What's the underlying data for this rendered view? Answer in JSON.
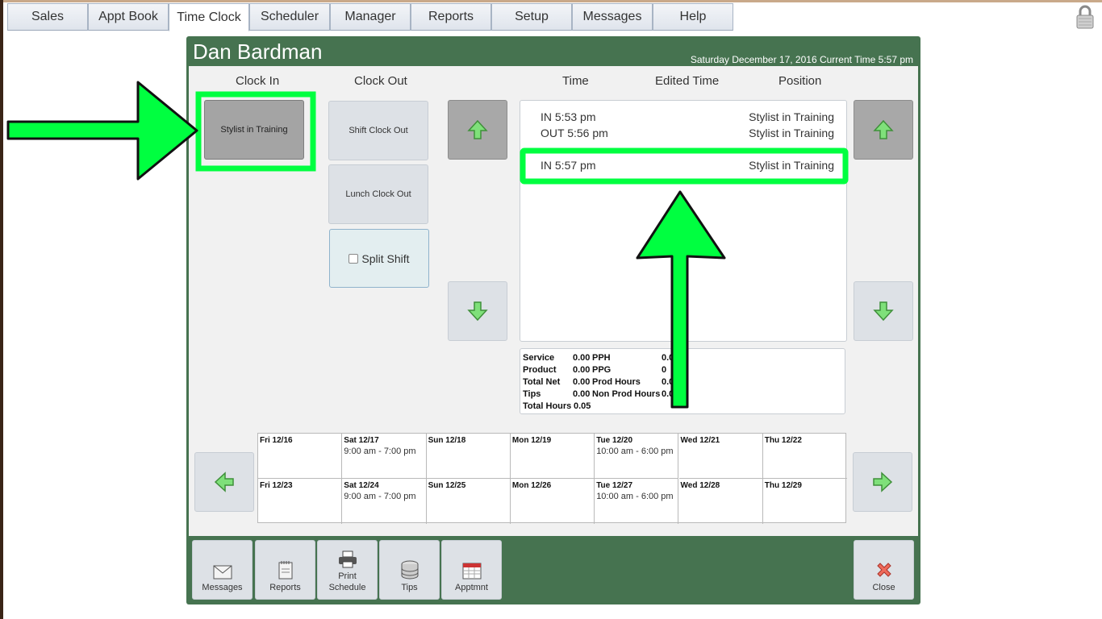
{
  "nav": {
    "tabs": [
      {
        "label": "Sales"
      },
      {
        "label": "Appt Book"
      },
      {
        "label": "Time Clock"
      },
      {
        "label": "Scheduler"
      },
      {
        "label": "Manager"
      },
      {
        "label": "Reports"
      },
      {
        "label": "Setup"
      },
      {
        "label": "Messages"
      },
      {
        "label": "Help"
      }
    ],
    "active": "Time Clock"
  },
  "header": {
    "employee_name": "Dan Bardman",
    "date_line": "Saturday December 17, 2016 Current Time 5:57 pm"
  },
  "columns": {
    "clock_in": "Clock In",
    "clock_out": "Clock Out",
    "time": "Time",
    "edited_time": "Edited Time",
    "position": "Position"
  },
  "clock_in_buttons": [
    "Stylist in Training"
  ],
  "clock_out_buttons": {
    "shift": "Shift Clock Out",
    "lunch": "Lunch Clock Out",
    "split_shift": "Split Shift"
  },
  "punches": [
    {
      "time": "IN 5:53 pm",
      "position": "Stylist in Training"
    },
    {
      "time": "OUT 5:56 pm",
      "position": "Stylist in Training"
    },
    {
      "time": "IN 5:57 pm",
      "position": "Stylist in Training"
    }
  ],
  "stats": {
    "service": {
      "label": "Service",
      "value": "0.00"
    },
    "product": {
      "label": "Product",
      "value": "0.00"
    },
    "total_net": {
      "label": "Total Net",
      "value": "0.00"
    },
    "tips": {
      "label": "Tips",
      "value": "0.00"
    },
    "total_hours": {
      "label": "Total Hours",
      "value": "0.05"
    },
    "pph": {
      "label": "PPH",
      "value": "0.0"
    },
    "ppg": {
      "label": "PPG",
      "value": "0"
    },
    "prod_hours": {
      "label": "Prod Hours",
      "value": "0.0"
    },
    "non_prod_hours": {
      "label": "Non Prod Hours",
      "value": "0.0"
    }
  },
  "schedule": {
    "week1": [
      {
        "day": "Fri 12/16",
        "shift": ""
      },
      {
        "day": "Sat 12/17",
        "shift": "9:00 am - 7:00 pm"
      },
      {
        "day": "Sun 12/18",
        "shift": ""
      },
      {
        "day": "Mon 12/19",
        "shift": ""
      },
      {
        "day": "Tue 12/20",
        "shift": "10:00 am - 6:00 pm"
      },
      {
        "day": "Wed 12/21",
        "shift": ""
      },
      {
        "day": "Thu 12/22",
        "shift": ""
      }
    ],
    "week2": [
      {
        "day": "Fri 12/23",
        "shift": ""
      },
      {
        "day": "Sat 12/24",
        "shift": "9:00 am - 7:00 pm"
      },
      {
        "day": "Sun 12/25",
        "shift": ""
      },
      {
        "day": "Mon 12/26",
        "shift": ""
      },
      {
        "day": "Tue 12/27",
        "shift": "10:00 am - 6:00 pm"
      },
      {
        "day": "Wed 12/28",
        "shift": ""
      },
      {
        "day": "Thu 12/29",
        "shift": ""
      }
    ]
  },
  "toolbar": {
    "messages": "Messages",
    "reports": "Reports",
    "print_schedule_1": "Print",
    "print_schedule_2": "Schedule",
    "tips": "Tips",
    "appointment": "Apptmnt",
    "close": "Close"
  },
  "colors": {
    "panel_green": "#467350",
    "callout_green": "#00ff40"
  }
}
